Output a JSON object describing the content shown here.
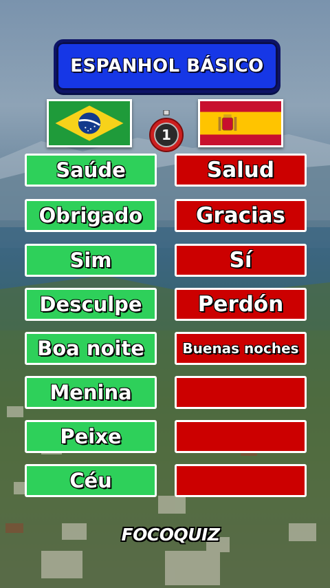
{
  "title": "ESPANHOL BÁSICO",
  "source_language_flag": "brazil-flag-icon",
  "target_language_flag": "spain-flag-icon",
  "timer_value": "1",
  "colors": {
    "title_banner": "#1637e6",
    "source_card": "#2ed05a",
    "target_card": "#cc0000",
    "timer_ring": "#cc1f1f"
  },
  "words": [
    {
      "pt": "Saúde",
      "es": "Salud"
    },
    {
      "pt": "Obrigado",
      "es": "Gracias"
    },
    {
      "pt": "Sim",
      "es": "Sí"
    },
    {
      "pt": "Desculpe",
      "es": "Perdón"
    },
    {
      "pt": "Boa noite",
      "es": "Buenas noches"
    },
    {
      "pt": "Menina",
      "es": ""
    },
    {
      "pt": "Peixe",
      "es": ""
    },
    {
      "pt": "Céu",
      "es": ""
    }
  ],
  "logo_text": "FOCOQUIZ"
}
